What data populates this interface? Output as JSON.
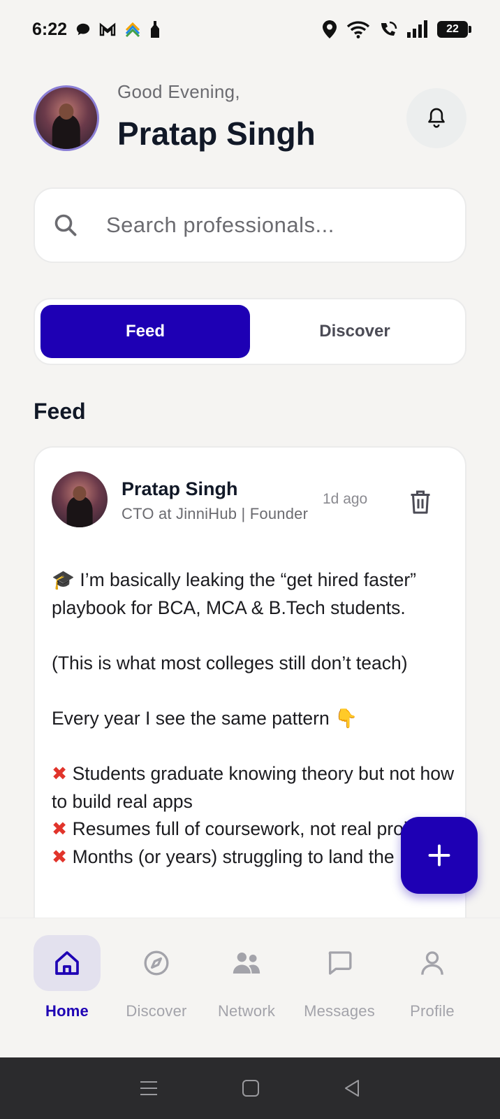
{
  "status_bar": {
    "time": "6:22",
    "battery": "22",
    "notification_icons": [
      "chat-bubble-icon",
      "gmail-icon",
      "app-icon",
      "bottle-icon"
    ],
    "system_icons": [
      "location-icon",
      "wifi-icon",
      "wifi-call-icon",
      "signal-icon",
      "battery-icon"
    ]
  },
  "header": {
    "greeting": "Good Evening,",
    "user_name": "Pratap Singh"
  },
  "search": {
    "placeholder": "Search professionals..."
  },
  "tabs": [
    {
      "label": "Feed",
      "active": true
    },
    {
      "label": "Discover",
      "active": false
    }
  ],
  "section_title": "Feed",
  "post": {
    "author": "Pratap Singh",
    "subtitle": "CTO at JinniHub | Founder",
    "time": "1d ago",
    "body": [
      "🎓 I’m basically leaking the “get hired faster” playbook for BCA, MCA & B.Tech students.",
      "(This is what most colleges still don’t teach)",
      "Every year I see the same pattern 👇"
    ],
    "bullets": [
      "Students graduate knowing theory but not how to build real apps",
      "Resumes full of coursework, not real projects",
      "Months (or years) struggling to land the"
    ]
  },
  "fab": {
    "icon": "plus-icon"
  },
  "bottom_nav": [
    {
      "label": "Home",
      "icon": "home-icon",
      "active": true
    },
    {
      "label": "Discover",
      "icon": "compass-icon",
      "active": false
    },
    {
      "label": "Network",
      "icon": "people-icon",
      "active": false
    },
    {
      "label": "Messages",
      "icon": "message-icon",
      "active": false
    },
    {
      "label": "Profile",
      "icon": "user-icon",
      "active": false
    }
  ],
  "colors": {
    "accent": "#1e00b4",
    "background": "#f5f4f2",
    "delete_mark": "#e1342b",
    "system_nav": "#2b2b2d"
  }
}
